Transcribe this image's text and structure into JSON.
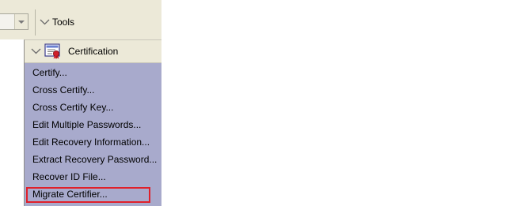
{
  "toolbar": {
    "tools_label": "Tools",
    "dropdown_icon": "chevron-down-icon"
  },
  "certification": {
    "header_label": "Certification",
    "icon": "certificate-icon",
    "items": [
      {
        "label": "Certify..."
      },
      {
        "label": "Cross Certify..."
      },
      {
        "label": "Cross Certify Key..."
      },
      {
        "label": "Edit Multiple Passwords..."
      },
      {
        "label": "Edit Recovery Information..."
      },
      {
        "label": "Extract Recovery Password..."
      },
      {
        "label": "Recover ID File..."
      },
      {
        "label": "Migrate Certifier..."
      }
    ],
    "highlighted_item": "Migrate Certifier..."
  },
  "colors": {
    "panel_bg": "#a8aacc",
    "toolbar_bg": "#ece9d8",
    "highlight": "#e0202a"
  }
}
